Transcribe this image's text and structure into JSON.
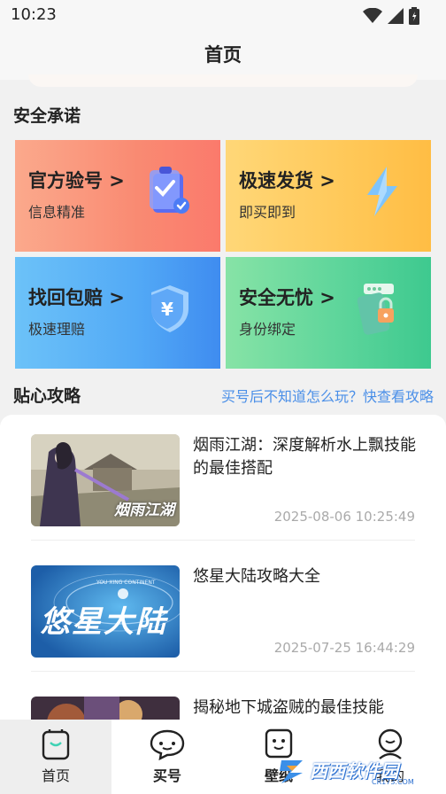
{
  "status_bar": {
    "time": "10:23",
    "icons": [
      "wifi-icon",
      "signal-icon",
      "battery-icon"
    ]
  },
  "header": {
    "title": "首页"
  },
  "promise_section": {
    "title": "安全承诺",
    "cards": [
      {
        "title": "官方验号 >",
        "subtitle": "信息精准",
        "icon": "clipboard-check-icon"
      },
      {
        "title": "极速发货 >",
        "subtitle": "即买即到",
        "icon": "lightning-icon"
      },
      {
        "title": "找回包赔 >",
        "subtitle": "极速理赔",
        "icon": "yuan-shield-icon"
      },
      {
        "title": "安全无忧 >",
        "subtitle": "身份绑定",
        "icon": "secure-phone-icon"
      }
    ]
  },
  "tips_section": {
    "title": "贴心攻略",
    "link": "买号后不知道怎么玩？快查看攻略"
  },
  "articles": [
    {
      "title": "烟雨江湖：深度解析水上飘技能的最佳搭配",
      "time": "2025-08-06 10:25:49",
      "thumb_text": "烟雨江湖"
    },
    {
      "title": "悠星大陆攻略大全",
      "time": "2025-07-25 16:44:29",
      "thumb_text": "悠星大陆",
      "thumb_small": "YOU XING CONTINENT"
    },
    {
      "title": "揭秘地下城盗贼的最佳技能",
      "time": ""
    }
  ],
  "tabs": [
    {
      "label": "首页",
      "icon": "home-icon",
      "active": true
    },
    {
      "label": "买号",
      "icon": "buy-chat-icon",
      "active": false
    },
    {
      "label": "壁纸",
      "icon": "wallpaper-icon",
      "active": false
    },
    {
      "label": "我的",
      "icon": "profile-icon",
      "active": false
    }
  ],
  "watermark": {
    "text": "西西软件园",
    "sub": "CR173.COM"
  }
}
